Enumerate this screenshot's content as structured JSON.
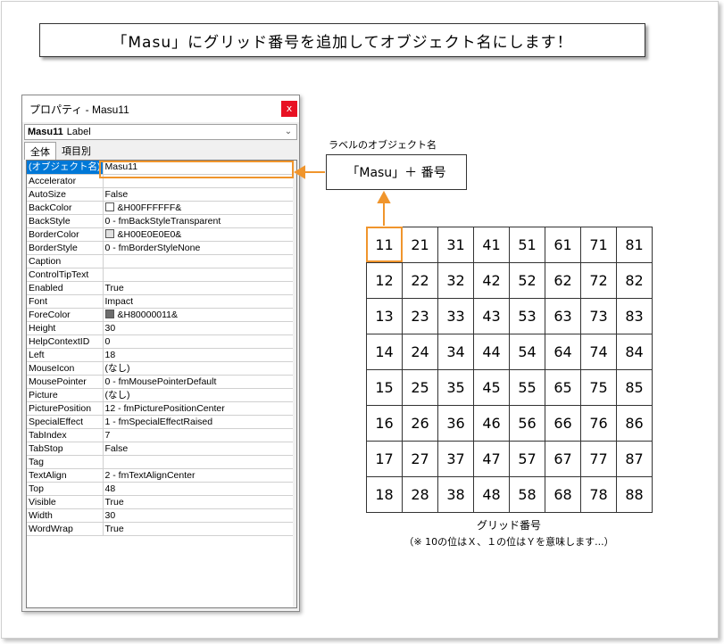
{
  "title": "「Masu」にグリッド番号を追加してオブジェクト名にします！",
  "properties_window": {
    "title": "プロパティ - Masu11",
    "close_glyph": "x",
    "object_name": "Masu11",
    "object_type": "Label",
    "tabs": [
      "全体",
      "項目別"
    ],
    "rows": [
      {
        "name": "(オブジェクト名)",
        "value": "Masu11"
      },
      {
        "name": "Accelerator",
        "value": ""
      },
      {
        "name": "AutoSize",
        "value": "False"
      },
      {
        "name": "BackColor",
        "value": "&H00FFFFFF&",
        "swatch": "#ffffff"
      },
      {
        "name": "BackStyle",
        "value": "0 - fmBackStyleTransparent"
      },
      {
        "name": "BorderColor",
        "value": "&H00E0E0E0&",
        "swatch": "#e0e0e0"
      },
      {
        "name": "BorderStyle",
        "value": "0 - fmBorderStyleNone"
      },
      {
        "name": "Caption",
        "value": ""
      },
      {
        "name": "ControlTipText",
        "value": ""
      },
      {
        "name": "Enabled",
        "value": "True"
      },
      {
        "name": "Font",
        "value": "Impact"
      },
      {
        "name": "ForeColor",
        "value": "&H80000011&",
        "swatch": "#6d6d6d"
      },
      {
        "name": "Height",
        "value": "30"
      },
      {
        "name": "HelpContextID",
        "value": "0"
      },
      {
        "name": "Left",
        "value": "18"
      },
      {
        "name": "MouseIcon",
        "value": "(なし)"
      },
      {
        "name": "MousePointer",
        "value": "0 - fmMousePointerDefault"
      },
      {
        "name": "Picture",
        "value": "(なし)"
      },
      {
        "name": "PicturePosition",
        "value": "12 - fmPicturePositionCenter"
      },
      {
        "name": "SpecialEffect",
        "value": "1 - fmSpecialEffectRaised"
      },
      {
        "name": "TabIndex",
        "value": "7"
      },
      {
        "name": "TabStop",
        "value": "False"
      },
      {
        "name": "Tag",
        "value": ""
      },
      {
        "name": "TextAlign",
        "value": "2 - fmTextAlignCenter"
      },
      {
        "name": "Top",
        "value": "48"
      },
      {
        "name": "Visible",
        "value": "True"
      },
      {
        "name": "Width",
        "value": "30"
      },
      {
        "name": "WordWrap",
        "value": "True"
      }
    ]
  },
  "callout": {
    "caption": "ラベルのオブジェクト名",
    "text": "「Masu」＋ 番号"
  },
  "grid": {
    "rows": [
      [
        "11",
        "21",
        "31",
        "41",
        "51",
        "61",
        "71",
        "81"
      ],
      [
        "12",
        "22",
        "32",
        "42",
        "52",
        "62",
        "72",
        "82"
      ],
      [
        "13",
        "23",
        "33",
        "43",
        "53",
        "63",
        "73",
        "83"
      ],
      [
        "14",
        "24",
        "34",
        "44",
        "54",
        "64",
        "74",
        "84"
      ],
      [
        "15",
        "25",
        "35",
        "45",
        "55",
        "65",
        "75",
        "85"
      ],
      [
        "16",
        "26",
        "36",
        "46",
        "56",
        "66",
        "76",
        "86"
      ],
      [
        "17",
        "27",
        "37",
        "47",
        "57",
        "67",
        "77",
        "87"
      ],
      [
        "18",
        "28",
        "38",
        "48",
        "58",
        "68",
        "78",
        "88"
      ]
    ],
    "caption": "グリッド番号",
    "note": "（※ 10の位はＸ、１の位はＹを意味します...）"
  },
  "colors": {
    "highlight": "#f0952c",
    "selection": "#0078d7",
    "close_button": "#e81123"
  }
}
